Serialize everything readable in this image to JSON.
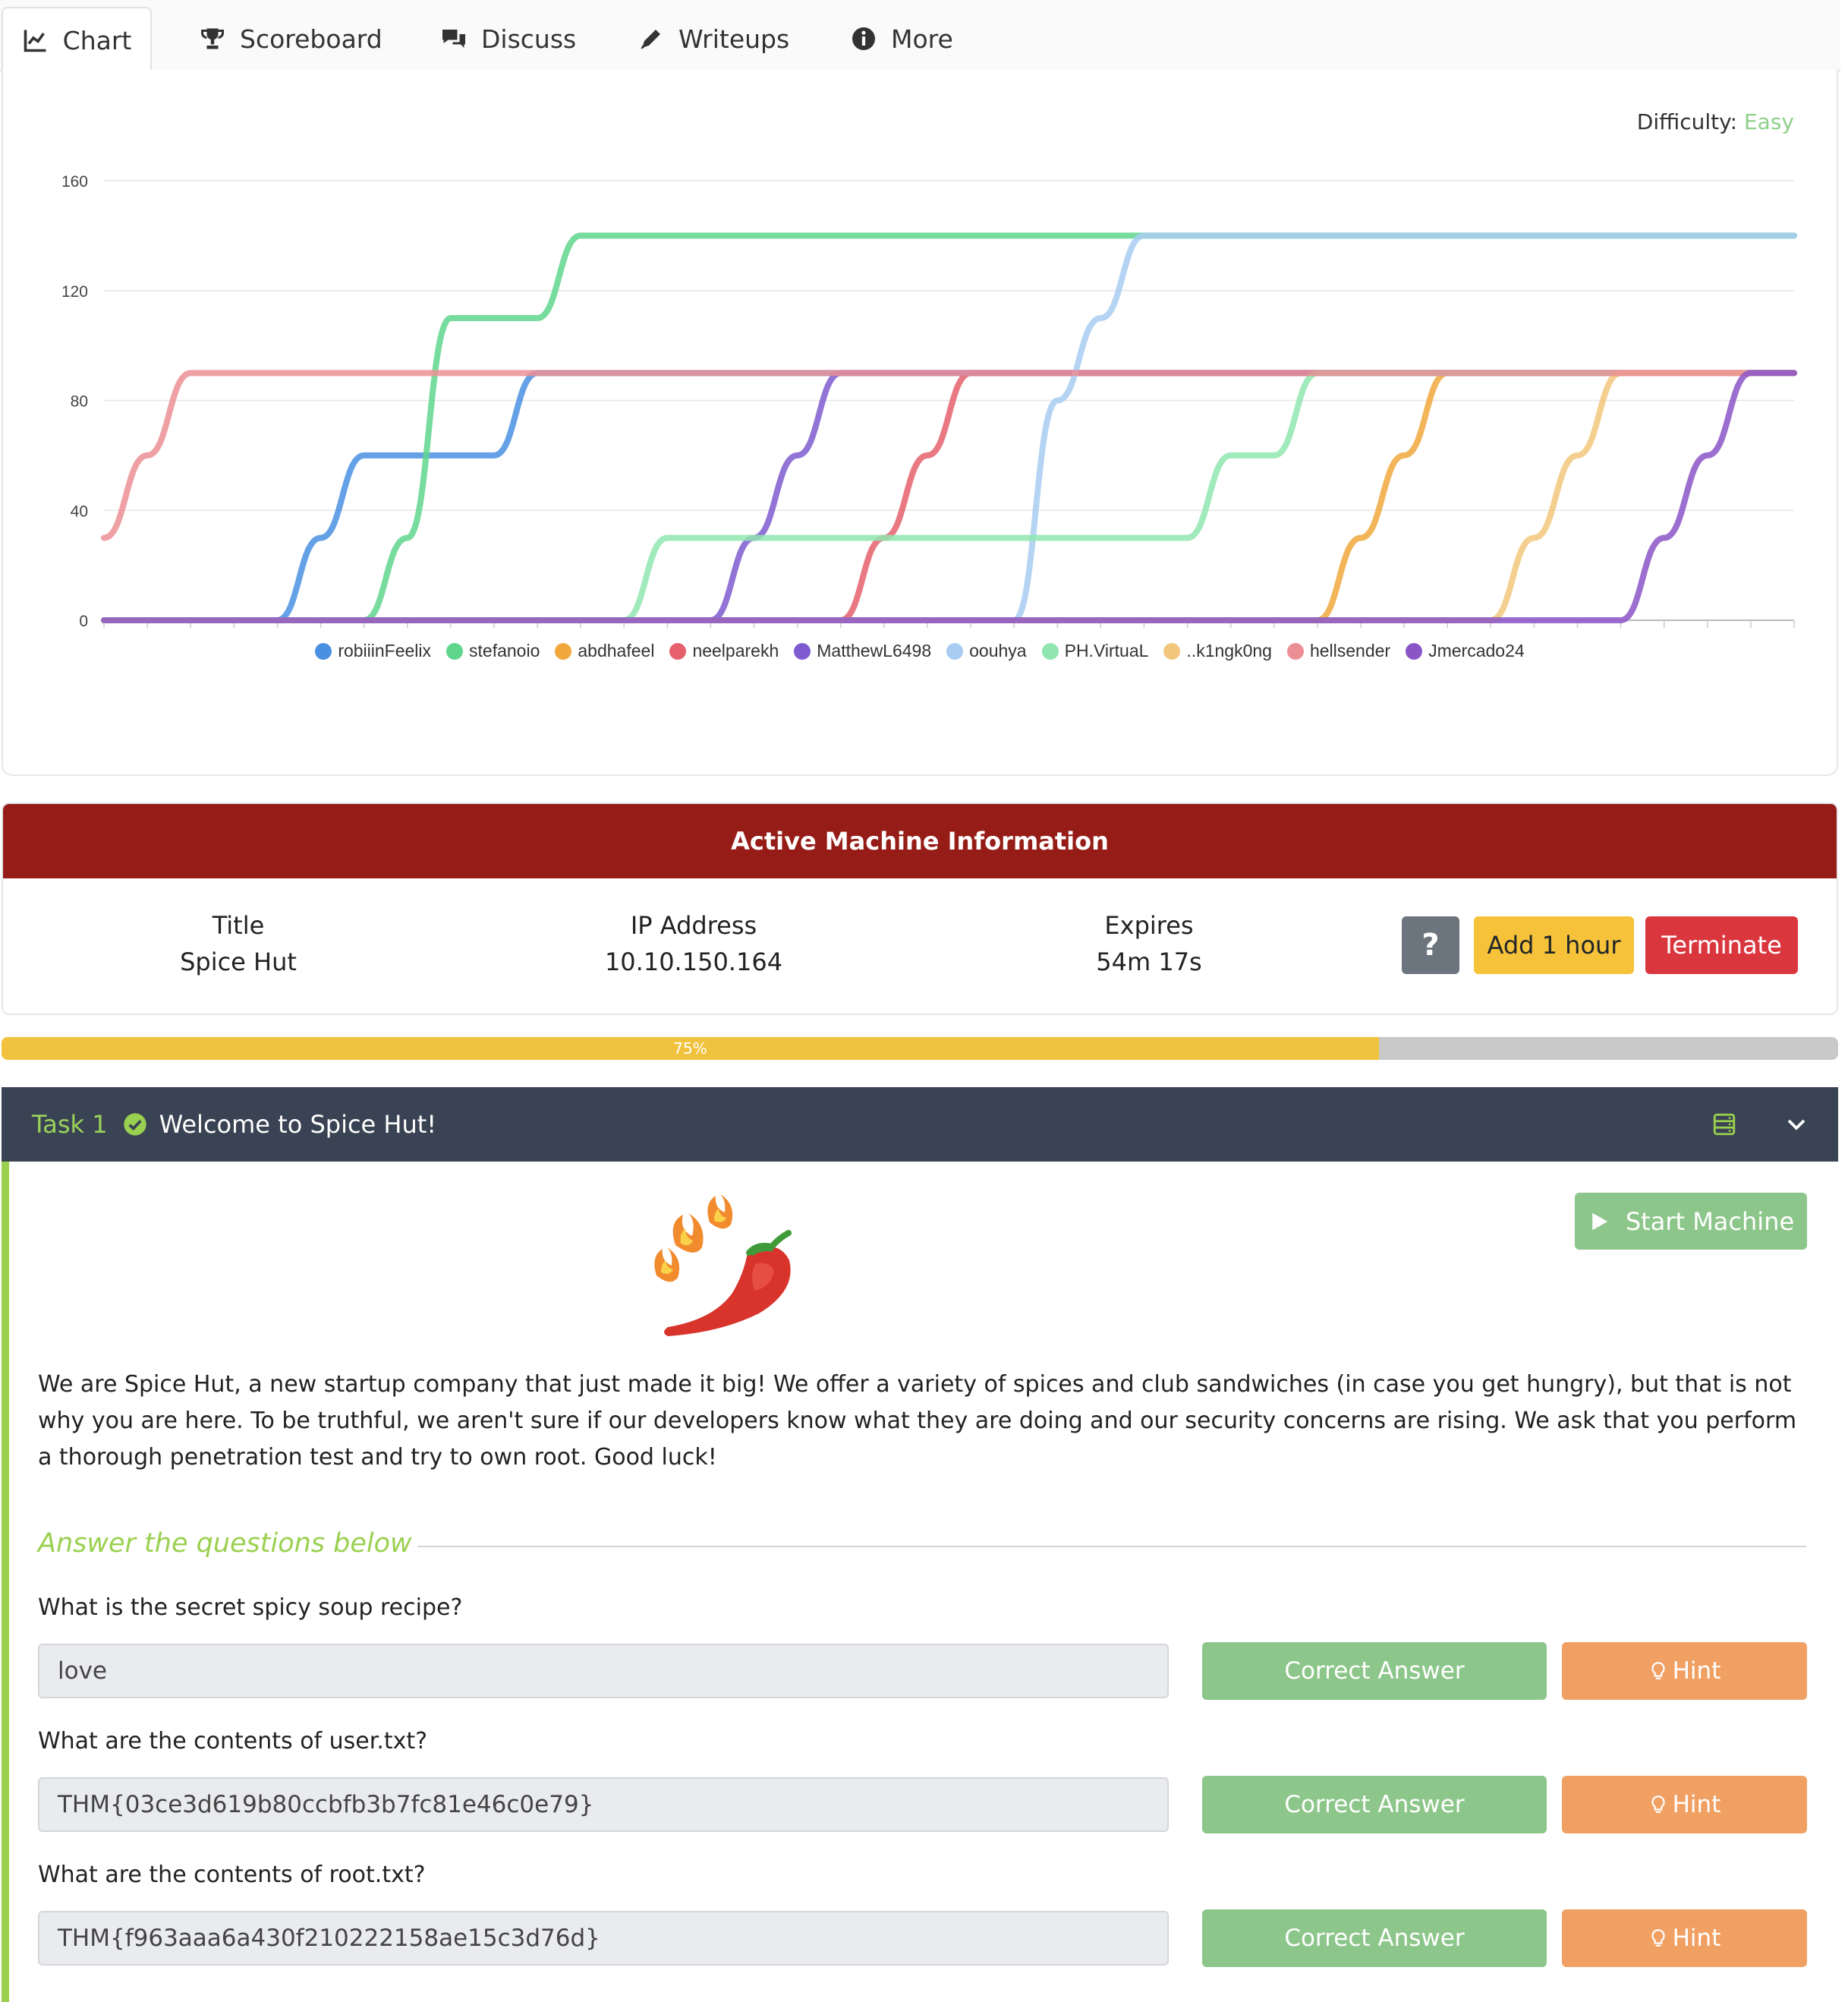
{
  "tabs": [
    {
      "label": "Chart",
      "icon": "chart-line-icon"
    },
    {
      "label": "Scoreboard",
      "icon": "trophy-icon"
    },
    {
      "label": "Discuss",
      "icon": "comments-icon"
    },
    {
      "label": "Writeups",
      "icon": "pen-icon"
    },
    {
      "label": "More",
      "icon": "info-circle-icon"
    }
  ],
  "difficulty": {
    "label": "Difficulty:",
    "value": "Easy",
    "color": "#8fcf8a"
  },
  "chart_data": {
    "type": "line",
    "title": "",
    "xlabel": "",
    "ylabel": "",
    "ylim": [
      0,
      160
    ],
    "yticks": [
      0,
      40,
      80,
      120,
      160
    ],
    "x": [
      0,
      1,
      2,
      3,
      4,
      5,
      6,
      7,
      8,
      9,
      10,
      11,
      12,
      13,
      14,
      15,
      16,
      17,
      18,
      19,
      20,
      21,
      22,
      23,
      24,
      25,
      26,
      27,
      28,
      29,
      30,
      31,
      32,
      33,
      34,
      35,
      36,
      37,
      38,
      39
    ],
    "grid": true,
    "legend_position": "bottom",
    "series": [
      {
        "name": "robiiinFeelix",
        "color": "#4a90e2",
        "values": [
          0,
          0,
          0,
          0,
          0,
          30,
          60,
          60,
          60,
          60,
          90,
          90,
          90,
          90,
          90,
          90,
          90,
          90,
          90,
          90,
          90,
          90,
          90,
          90,
          90,
          90,
          90,
          90,
          90,
          90,
          90,
          90,
          90,
          90,
          90,
          90,
          90,
          90,
          90,
          90
        ]
      },
      {
        "name": "stefanoio",
        "color": "#5fd68c",
        "values": [
          0,
          0,
          0,
          0,
          0,
          0,
          0,
          30,
          110,
          110,
          110,
          140,
          140,
          140,
          140,
          140,
          140,
          140,
          140,
          140,
          140,
          140,
          140,
          140,
          140,
          140,
          140,
          140,
          140,
          140,
          140,
          140,
          140,
          140,
          140,
          140,
          140,
          140,
          140,
          140
        ]
      },
      {
        "name": "abdhafeel",
        "color": "#f0a83c",
        "values": [
          0,
          0,
          0,
          0,
          0,
          0,
          0,
          0,
          0,
          0,
          0,
          0,
          0,
          0,
          0,
          0,
          0,
          0,
          0,
          0,
          0,
          0,
          0,
          0,
          0,
          0,
          0,
          0,
          0,
          30,
          60,
          90,
          90,
          90,
          90,
          90,
          90,
          90,
          90,
          90
        ]
      },
      {
        "name": "neelparekh",
        "color": "#e5606c",
        "values": [
          0,
          0,
          0,
          0,
          0,
          0,
          0,
          0,
          0,
          0,
          0,
          0,
          0,
          0,
          0,
          0,
          0,
          0,
          30,
          60,
          90,
          90,
          90,
          90,
          90,
          90,
          90,
          90,
          90,
          90,
          90,
          90,
          90,
          90,
          90,
          90,
          90,
          90,
          90,
          90
        ]
      },
      {
        "name": "MatthewL6498",
        "color": "#7e5ccf",
        "values": [
          0,
          0,
          0,
          0,
          0,
          0,
          0,
          0,
          0,
          0,
          0,
          0,
          0,
          0,
          0,
          30,
          60,
          90,
          90,
          90,
          90,
          90,
          90,
          90,
          90,
          90,
          90,
          90,
          90,
          90,
          90,
          90,
          90,
          90,
          90,
          90,
          90,
          90,
          90,
          90
        ]
      },
      {
        "name": "oouhya",
        "color": "#a8ccf2",
        "values": [
          0,
          0,
          0,
          0,
          0,
          0,
          0,
          0,
          0,
          0,
          0,
          0,
          0,
          0,
          0,
          0,
          0,
          0,
          0,
          0,
          0,
          0,
          80,
          110,
          140,
          140,
          140,
          140,
          140,
          140,
          140,
          140,
          140,
          140,
          140,
          140,
          140,
          140,
          140,
          140
        ]
      },
      {
        "name": "PH.VirtuaL",
        "color": "#8fe6b0",
        "values": [
          0,
          0,
          0,
          0,
          0,
          0,
          0,
          0,
          0,
          0,
          0,
          0,
          0,
          30,
          30,
          30,
          30,
          30,
          30,
          30,
          30,
          30,
          30,
          30,
          30,
          30,
          60,
          60,
          90,
          90,
          90,
          90,
          90,
          90,
          90,
          90,
          90,
          90,
          90,
          90
        ]
      },
      {
        "name": "..k1ngk0ng",
        "color": "#f2c77c",
        "values": [
          0,
          0,
          0,
          0,
          0,
          0,
          0,
          0,
          0,
          0,
          0,
          0,
          0,
          0,
          0,
          0,
          0,
          0,
          0,
          0,
          0,
          0,
          0,
          0,
          0,
          0,
          0,
          0,
          0,
          0,
          0,
          0,
          0,
          30,
          60,
          90,
          90,
          90,
          90,
          90
        ]
      },
      {
        "name": "hellsender",
        "color": "#ec8f94",
        "values": [
          30,
          60,
          90,
          90,
          90,
          90,
          90,
          90,
          90,
          90,
          90,
          90,
          90,
          90,
          90,
          90,
          90,
          90,
          90,
          90,
          90,
          90,
          90,
          90,
          90,
          90,
          90,
          90,
          90,
          90,
          90,
          90,
          90,
          90,
          90,
          90,
          90,
          90,
          90,
          90
        ]
      },
      {
        "name": "Jmercado24",
        "color": "#8a55c7",
        "values": [
          0,
          0,
          0,
          0,
          0,
          0,
          0,
          0,
          0,
          0,
          0,
          0,
          0,
          0,
          0,
          0,
          0,
          0,
          0,
          0,
          0,
          0,
          0,
          0,
          0,
          0,
          0,
          0,
          0,
          0,
          0,
          0,
          0,
          0,
          0,
          0,
          30,
          60,
          90,
          90
        ]
      }
    ]
  },
  "machine": {
    "header": "Active Machine Information",
    "title_label": "Title",
    "title_value": "Spice Hut",
    "ip_label": "IP Address",
    "ip_value": "10.10.150.164",
    "expires_label": "Expires",
    "expires_value": "54m 17s",
    "help_label": "?",
    "add_label": "Add 1 hour",
    "terminate_label": "Terminate"
  },
  "progress": {
    "label": "75%",
    "fraction": 0.75
  },
  "task": {
    "number": "Task 1",
    "title": "Welcome to Spice Hut!",
    "start_label": "Start Machine",
    "description": "We are Spice Hut, a new startup company that just made it big! We offer a variety of spices and club sandwiches (in case you get hungry), but that is not why you are here. To be truthful, we aren't sure if our developers know what they are doing and our security concerns are rising. We ask that you perform a thorough penetration test and try to own root. Good luck!",
    "answer_heading": "Answer the questions below",
    "questions": [
      {
        "question": "What is the secret spicy soup recipe?",
        "answer": "love",
        "status": "Correct Answer",
        "hint": "Hint"
      },
      {
        "question": "What are the contents of user.txt?",
        "answer": "THM{03ce3d619b80ccbfb3b7fc81e46c0e79}",
        "status": "Correct Answer",
        "hint": "Hint"
      },
      {
        "question": "What are the contents of root.txt?",
        "answer": "THM{f963aaa6a430f210222158ae15c3d76d}",
        "status": "Correct Answer",
        "hint": "Hint"
      }
    ]
  }
}
